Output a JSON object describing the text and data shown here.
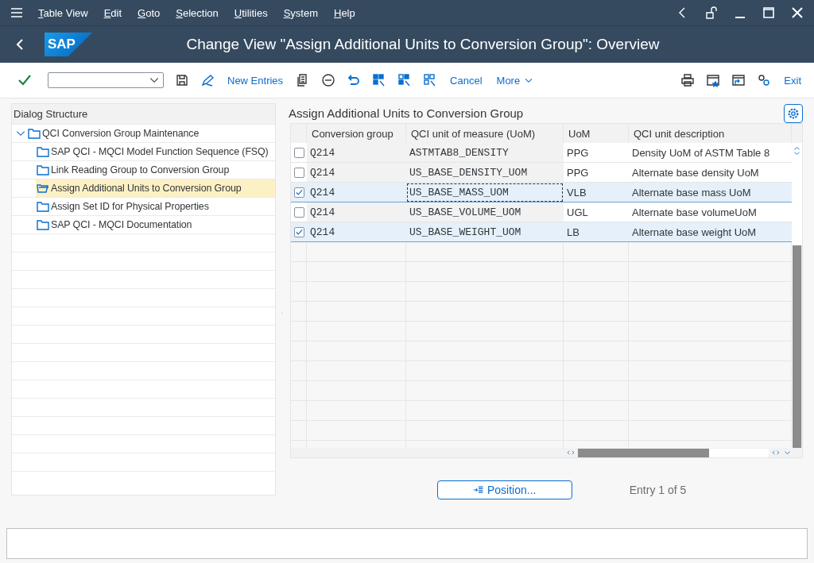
{
  "menu_bar": {
    "items": [
      "Table View",
      "Edit",
      "Goto",
      "Selection",
      "Utilities",
      "System",
      "Help"
    ]
  },
  "title_bar": {
    "title": "Change View \"Assign Additional Units to Conversion Group\": Overview",
    "logo": "SAP"
  },
  "toolbar": {
    "buttons": [
      {
        "kind": "text",
        "label": "New Entries"
      },
      {
        "kind": "text",
        "label": "Cancel"
      },
      {
        "kind": "menu",
        "label": "More"
      },
      {
        "kind": "text",
        "label": "Exit"
      }
    ]
  },
  "dialog_structure": {
    "title": "Dialog Structure",
    "tree": [
      {
        "label": "QCI Conversion Group Maintenance",
        "expanded": true,
        "selected": false,
        "children": [
          {
            "label": "SAP QCI - MQCI Model Function Sequence (FSQ)",
            "selected": false
          },
          {
            "label": "Link Reading Group to Conversion Group",
            "selected": false
          },
          {
            "label": "Assign Additional Units to Conversion Group",
            "selected": true
          },
          {
            "label": "Assign Set ID for Physical Properties",
            "selected": false
          },
          {
            "label": "SAP QCI - MQCI Documentation",
            "selected": false
          }
        ]
      }
    ]
  },
  "table": {
    "title": "Assign Additional Units to Conversion Group",
    "columns": [
      "Conversion group",
      "QCI unit of measure (UoM)",
      "UoM",
      "QCI unit description"
    ],
    "rows": [
      {
        "cells": [
          "Q214",
          "ASTMTAB8_DENSITY",
          "PPG",
          "Density UoM of ASTM Table 8"
        ],
        "selected": false,
        "focused": false
      },
      {
        "cells": [
          "Q214",
          "US_BASE_DENSITY_UOM",
          "PPG",
          "Alternate base density UoM"
        ],
        "selected": false,
        "focused": false
      },
      {
        "cells": [
          "Q214",
          "US_BASE_MASS_UOM",
          "VLB",
          "Alternate base mass UoM"
        ],
        "selected": true,
        "focused": true
      },
      {
        "cells": [
          "Q214",
          "US_BASE_VOLUME_UOM",
          "UGL",
          "Alternate base volumeUoM"
        ],
        "selected": false,
        "focused": false
      },
      {
        "cells": [
          "Q214",
          "US_BASE_WEIGHT_UOM",
          "LB",
          "Alternate base weight UoM"
        ],
        "selected": true,
        "focused": false
      }
    ]
  },
  "footer": {
    "position_button": "Position...",
    "entry_info": "Entry 1 of 5"
  }
}
